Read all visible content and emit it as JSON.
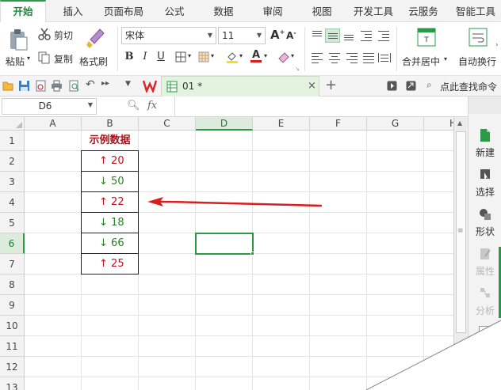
{
  "menu": {
    "tabs": [
      "开始",
      "插入",
      "页面布局",
      "公式",
      "数据",
      "审阅",
      "视图",
      "开发工具",
      "云服务",
      "智能工具"
    ],
    "active": "开始"
  },
  "ribbon": {
    "paste": "粘贴",
    "cut": "剪切",
    "copy": "复制",
    "format_painter": "格式刷",
    "font_name": "宋体",
    "font_size": "11",
    "bold": "B",
    "italic": "I",
    "underline": "U",
    "merge_center": "合并居中",
    "wrap_text": "自动换行"
  },
  "quickbar": {
    "doc_tab": "01 *",
    "find_command": "点此查找命令"
  },
  "formula_bar": {
    "name_box": "D6",
    "fx": "fx",
    "formula": ""
  },
  "sheet": {
    "columns": [
      "A",
      "B",
      "C",
      "D",
      "E",
      "F",
      "G",
      "H"
    ],
    "rows": [
      "1",
      "2",
      "3",
      "4",
      "5",
      "6",
      "7",
      "8",
      "9",
      "10",
      "11",
      "12",
      "13"
    ],
    "selected_cell": "D6",
    "header_cell": "示例数据",
    "data": [
      {
        "arrow": "↑",
        "direction": "up",
        "value": "20"
      },
      {
        "arrow": "↓",
        "direction": "down",
        "value": "50"
      },
      {
        "arrow": "↑",
        "direction": "up",
        "value": "22"
      },
      {
        "arrow": "↓",
        "direction": "down",
        "value": "18"
      },
      {
        "arrow": "↓",
        "direction": "down",
        "value": "66"
      },
      {
        "arrow": "↑",
        "direction": "up",
        "value": "25"
      }
    ]
  },
  "right_panel": {
    "items": [
      "新建",
      "选择",
      "形状",
      "属性",
      "分析"
    ]
  },
  "colors": {
    "accent_green": "#2a9a47",
    "up_red": "#c0121f",
    "down_green": "#2f7d28",
    "header_red": "#a8141c",
    "annotation_arrow": "#d81e1e"
  }
}
